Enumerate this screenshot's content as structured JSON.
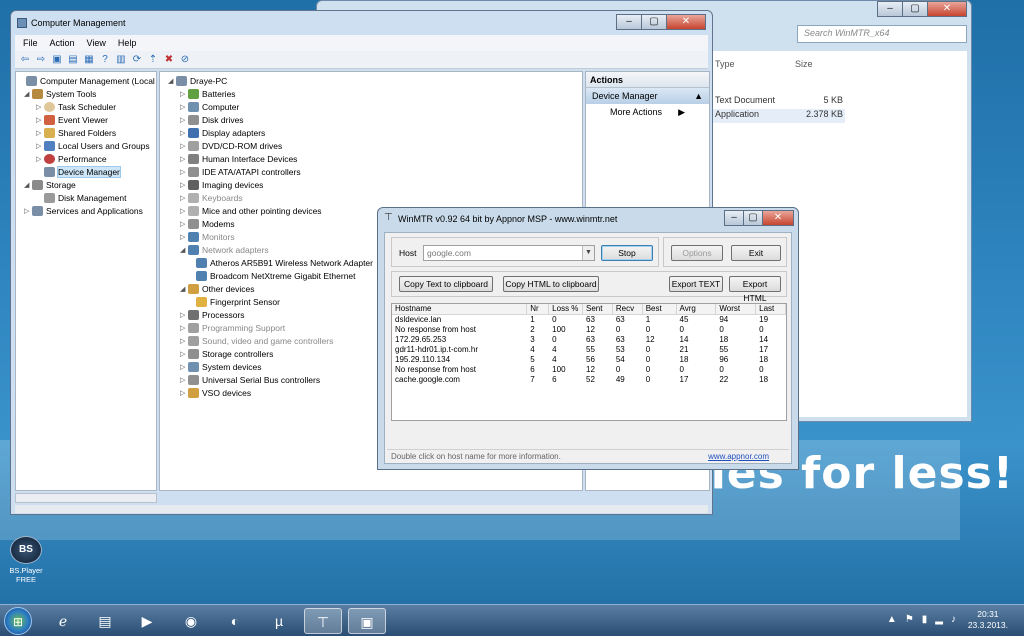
{
  "desktop": {
    "banner": "your memories for less!",
    "icon_label_1": "BS.Player",
    "icon_label_2": "FREE"
  },
  "explorer": {
    "search_placeholder": "Search WinMTR_x64",
    "col_type": "Type",
    "col_size": "Size",
    "rows": [
      {
        "type": "Text Document",
        "size": "5 KB"
      },
      {
        "type": "Application",
        "size": "2.378 KB"
      }
    ]
  },
  "cm": {
    "title": "Computer Management",
    "menu": [
      "File",
      "Action",
      "View",
      "Help"
    ],
    "left_tree": [
      "Computer Management (Local",
      "System Tools",
      "Task Scheduler",
      "Event Viewer",
      "Shared Folders",
      "Local Users and Groups",
      "Performance",
      "Device Manager",
      "Storage",
      "Disk Management",
      "Services and Applications"
    ],
    "device_tree": [
      "Draye-PC",
      "Batteries",
      "Computer",
      "Disk drives",
      "Display adapters",
      "DVD/CD-ROM drives",
      "Human Interface Devices",
      "IDE ATA/ATAPI controllers",
      "Imaging devices",
      "Keyboards",
      "Mice and other pointing devices",
      "Modems",
      "Monitors",
      "Network adapters",
      "Atheros AR5B91 Wireless Network Adapter",
      "Broadcom NetXtreme Gigabit Ethernet",
      "Other devices",
      "Fingerprint Sensor",
      "Processors",
      "Programming Support",
      "Sound, video and game controllers",
      "Storage controllers",
      "System devices",
      "Universal Serial Bus controllers",
      "VSO devices"
    ],
    "actions_head": "Actions",
    "actions_sub": "Device Manager",
    "actions_more": "More Actions"
  },
  "mtr": {
    "title": "WinMTR v0.92 64 bit by Appnor MSP - www.winmtr.net",
    "host_label": "Host",
    "host_value": "google.com",
    "stop": "Stop",
    "options": "Options",
    "exit": "Exit",
    "copy_text": "Copy Text to clipboard",
    "copy_html": "Copy HTML to clipboard",
    "export_text": "Export TEXT",
    "export_html": "Export HTML",
    "columns": [
      "Hostname",
      "Nr",
      "Loss %",
      "Sent",
      "Recv",
      "Best",
      "Avrg",
      "Worst",
      "Last"
    ],
    "rows": [
      [
        "dsldevice.lan",
        "1",
        "0",
        "63",
        "63",
        "1",
        "45",
        "94",
        "19"
      ],
      [
        "No response from host",
        "2",
        "100",
        "12",
        "0",
        "0",
        "0",
        "0",
        "0"
      ],
      [
        "172.29.65.253",
        "3",
        "0",
        "63",
        "63",
        "12",
        "14",
        "18",
        "14"
      ],
      [
        "gdr11-hdr01.ip.t-com.hr",
        "4",
        "4",
        "55",
        "53",
        "0",
        "21",
        "55",
        "17"
      ],
      [
        "195.29.110.134",
        "5",
        "4",
        "56",
        "54",
        "0",
        "18",
        "96",
        "18"
      ],
      [
        "No response from host",
        "6",
        "100",
        "12",
        "0",
        "0",
        "0",
        "0",
        "0"
      ],
      [
        "cache.google.com",
        "7",
        "6",
        "52",
        "49",
        "0",
        "17",
        "22",
        "18"
      ]
    ],
    "status": "Double click on host name for more information.",
    "link": "www.appnor.com"
  },
  "taskbar": {
    "time": "20:31",
    "date": "23.3.2013."
  }
}
